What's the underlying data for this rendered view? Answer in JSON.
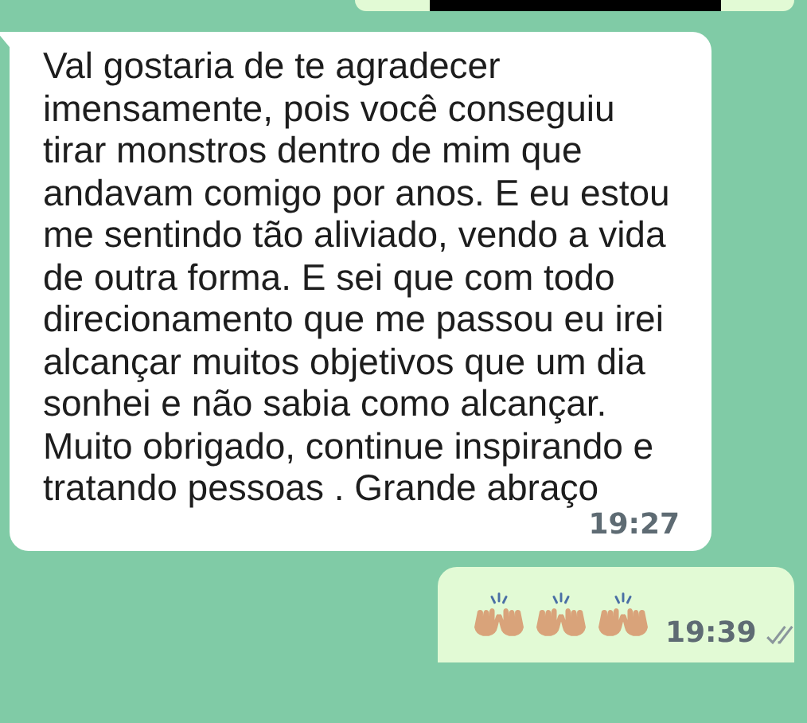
{
  "messages": [
    {
      "kind": "sent-cut",
      "redacted": true
    },
    {
      "kind": "received",
      "text": "Val gostaria de te agradecer imensamente,  pois você conseguiu tirar monstros dentro de mim que andavam comigo por anos. E eu estou me sentindo tão aliviado, vendo a vida de outra forma. E sei que com todo direcionamento que me passou eu irei alcançar muitos objetivos que um dia sonhei e não sabia como alcançar.  Muito obrigado,  continue inspirando e tratando pessoas . Grande abraço",
      "time": "19:27"
    },
    {
      "kind": "sent",
      "emojis": [
        {
          "kind": "raised-hands"
        },
        {
          "kind": "raised-hands"
        },
        {
          "kind": "raised-hands"
        }
      ],
      "time": "19:39",
      "read": false
    }
  ]
}
